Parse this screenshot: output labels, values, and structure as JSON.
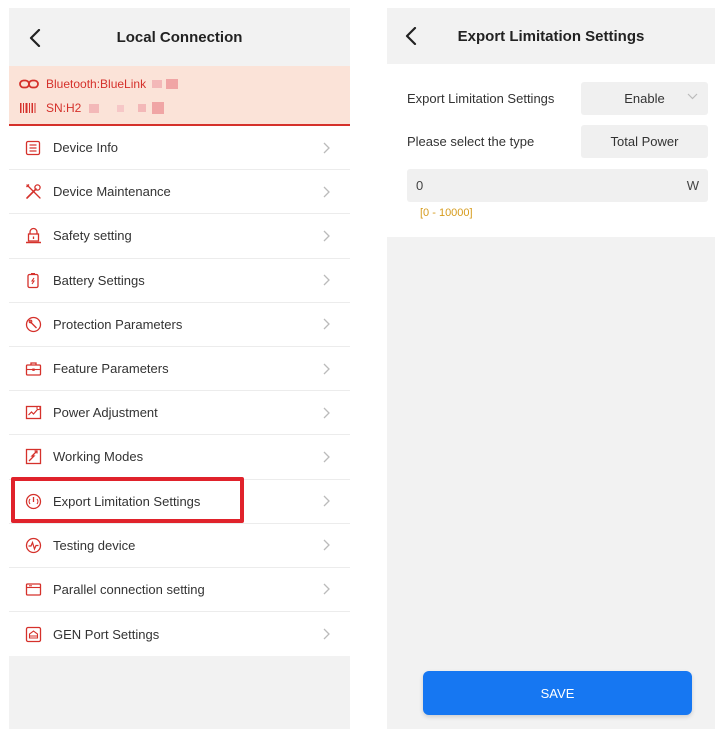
{
  "left": {
    "header": {
      "title": "Local Connection"
    },
    "connection": {
      "bluetooth_label": "Bluetooth:BlueLink",
      "sn_label": "SN:H2"
    },
    "menu": [
      {
        "label": "Device Info",
        "icon": "document-list-icon"
      },
      {
        "label": "Device Maintenance",
        "icon": "wrench-tools-icon"
      },
      {
        "label": "Safety setting",
        "icon": "safety-lock-icon"
      },
      {
        "label": "Battery Settings",
        "icon": "battery-icon"
      },
      {
        "label": "Protection Parameters",
        "icon": "protection-icon"
      },
      {
        "label": "Feature Parameters",
        "icon": "briefcase-icon"
      },
      {
        "label": "Power Adjustment",
        "icon": "power-chart-icon"
      },
      {
        "label": "Working Modes",
        "icon": "mode-switch-icon"
      },
      {
        "label": "Export Limitation Settings",
        "icon": "export-limit-icon"
      },
      {
        "label": "Testing device",
        "icon": "test-pulse-icon"
      },
      {
        "label": "Parallel connection setting",
        "icon": "parallel-card-icon"
      },
      {
        "label": "GEN Port Settings",
        "icon": "gen-port-icon"
      }
    ]
  },
  "right": {
    "header": {
      "title": "Export Limitation Settings"
    },
    "form": {
      "export_limit_label": "Export Limitation Settings",
      "export_limit_value": "Enable",
      "type_label": "Please select the type",
      "type_value": "Total Power",
      "power_value": "0",
      "power_unit": "W",
      "range_hint": "[0 - 10000]"
    },
    "save_label": "SAVE"
  },
  "colors": {
    "accent_red": "#d5312b",
    "banner_bg": "#fbe3d8",
    "primary_blue": "#1677f2",
    "hint_orange": "#d69b1c",
    "highlight_red": "#e0222b"
  }
}
